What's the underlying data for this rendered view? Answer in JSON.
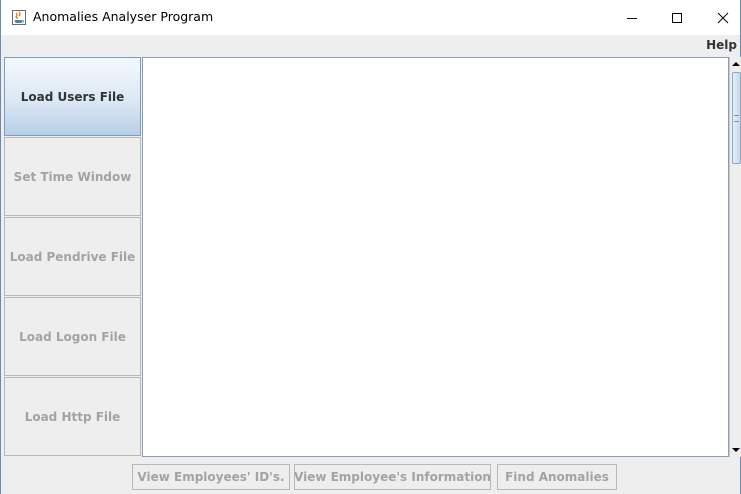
{
  "window": {
    "title": "Anomalies Analyser Program",
    "icon": "java-cup-icon"
  },
  "menubar": {
    "help_label": "Help"
  },
  "sidebar": {
    "buttons": [
      {
        "label": "Load Users File",
        "enabled": true
      },
      {
        "label": "Set Time Window",
        "enabled": false
      },
      {
        "label": "Load Pendrive File",
        "enabled": false
      },
      {
        "label": "Load Logon File",
        "enabled": false
      },
      {
        "label": "Load Http File",
        "enabled": false
      }
    ]
  },
  "bottom_bar": {
    "buttons": [
      {
        "label": "View Employees' ID's.",
        "enabled": false
      },
      {
        "label": "View Employee's Information",
        "enabled": false
      },
      {
        "label": "Find Anomalies",
        "enabled": false
      }
    ]
  },
  "colors": {
    "accent_active": "#b8cfe6",
    "disabled_text": "#a3a3a3",
    "border_blue": "#6a8cb4"
  }
}
